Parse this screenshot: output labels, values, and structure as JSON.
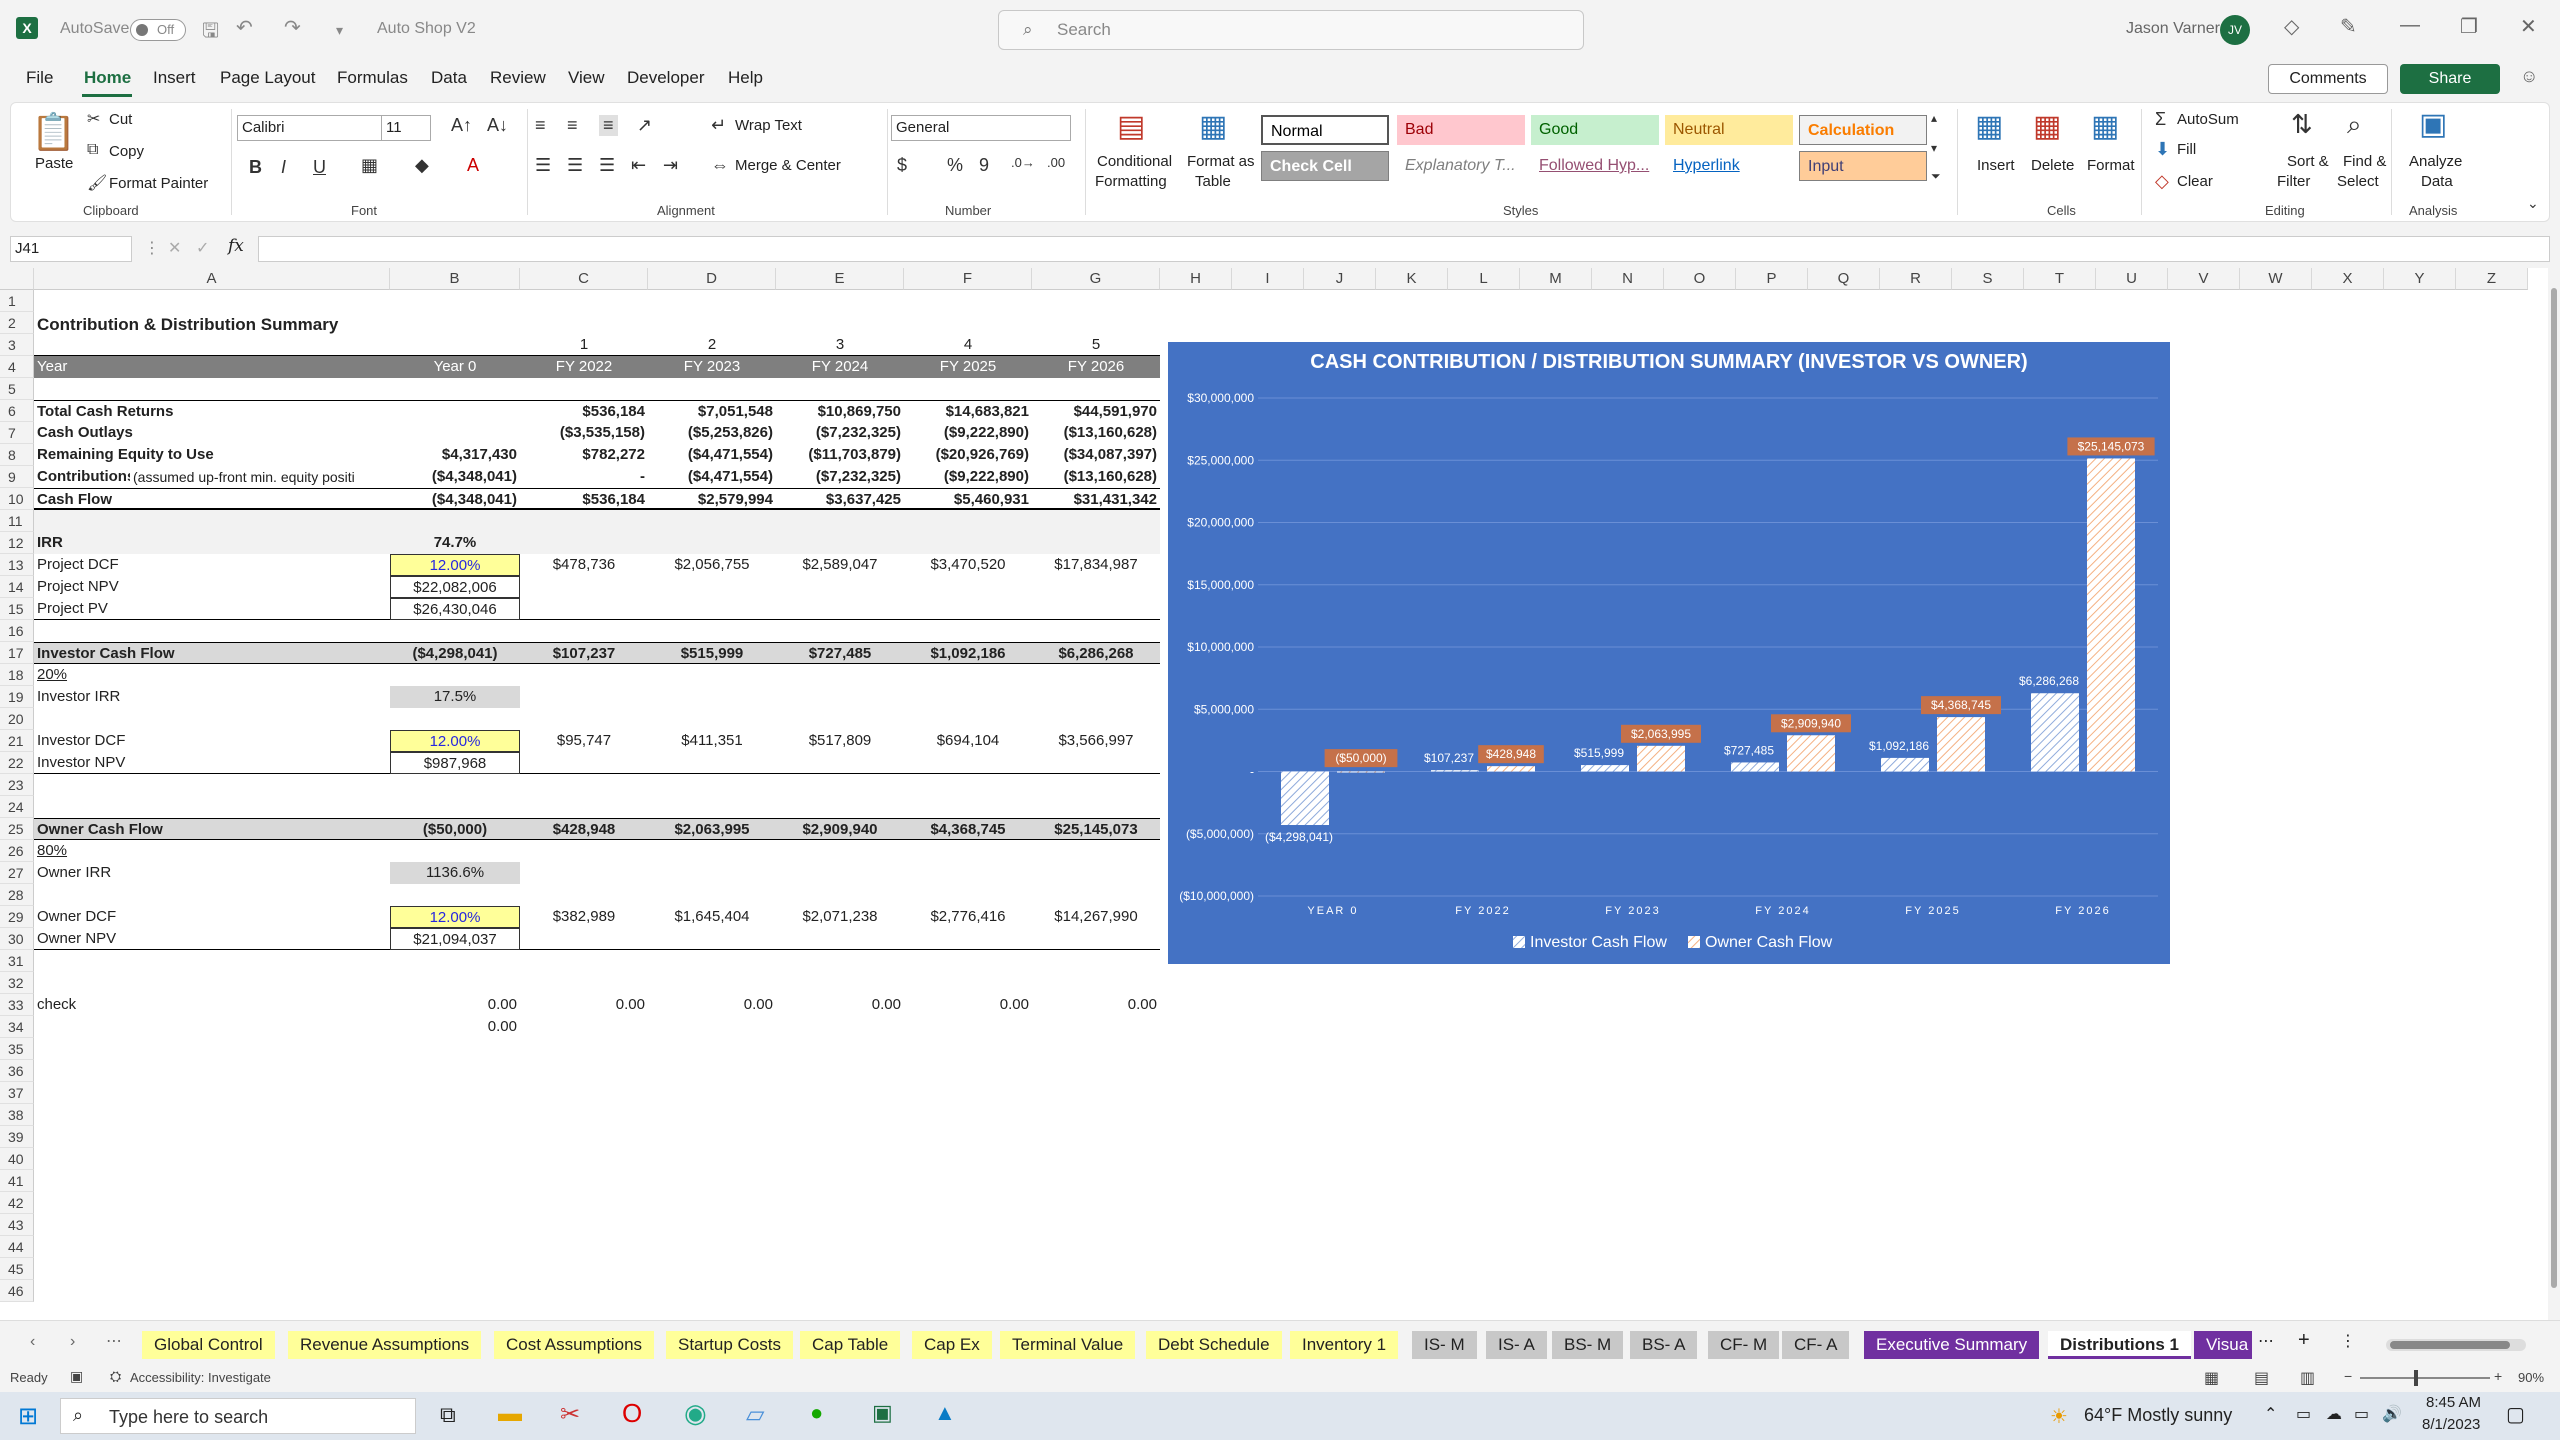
{
  "titlebar": {
    "autosave": "AutoSave",
    "toggle": "Off",
    "filename": "Auto Shop V2",
    "search_placeholder": "Search",
    "user": "Jason Varner",
    "initials": "JV"
  },
  "menu": [
    "File",
    "Home",
    "Insert",
    "Page Layout",
    "Formulas",
    "Data",
    "Review",
    "View",
    "Developer",
    "Help"
  ],
  "menu_buttons": {
    "comments": "Comments",
    "share": "Share"
  },
  "ribbon": {
    "paste": "Paste",
    "cut": "Cut",
    "copy": "Copy",
    "format_painter": "Format Painter",
    "clipboard": "Clipboard",
    "font_name": "Calibri",
    "font_size": "11",
    "font": "Font",
    "wrap_text": "Wrap Text",
    "merge_center": "Merge & Center",
    "alignment": "Alignment",
    "number_format": "General",
    "number": "Number",
    "conditional": "Conditional",
    "formatting": "Formatting",
    "format_as": "Format as",
    "table": "Table",
    "styles": [
      {
        "name": "Normal",
        "bg": "#ffffff",
        "fg": "#000000"
      },
      {
        "name": "Bad",
        "bg": "#ffc7ce",
        "fg": "#9c0006"
      },
      {
        "name": "Good",
        "bg": "#c6efce",
        "fg": "#006100"
      },
      {
        "name": "Neutral",
        "bg": "#ffeb9c",
        "fg": "#9c5700"
      },
      {
        "name": "Calculation",
        "bg": "#f2f2f2",
        "fg": "#fa7d00"
      },
      {
        "name": "Check Cell",
        "bg": "#a5a5a5",
        "fg": "#ffffff"
      },
      {
        "name": "Explanatory T...",
        "bg": "#ffffff",
        "fg": "#7f7f7f"
      },
      {
        "name": "Followed Hyp...",
        "bg": "#ffffff",
        "fg": "#954f72"
      },
      {
        "name": "Hyperlink",
        "bg": "#ffffff",
        "fg": "#0563c1"
      },
      {
        "name": "Input",
        "bg": "#ffcc99",
        "fg": "#3f3f76"
      }
    ],
    "styles_label": "Styles",
    "insert": "Insert",
    "delete": "Delete",
    "format": "Format",
    "cells": "Cells",
    "autosum": "AutoSum",
    "fill": "Fill",
    "clear": "Clear",
    "sort_filter": "Sort &",
    "filter": "Filter",
    "find_select": "Find &",
    "select": "Select",
    "editing": "Editing",
    "analyze": "Analyze",
    "data": "Data",
    "analysis": "Analysis"
  },
  "namebox": "J41",
  "columns": [
    "A",
    "B",
    "C",
    "D",
    "E",
    "F",
    "G",
    "H",
    "I",
    "J",
    "K",
    "L",
    "M",
    "N",
    "O",
    "P",
    "Q",
    "R",
    "S",
    "T",
    "U",
    "V",
    "W",
    "X",
    "Y",
    "Z"
  ],
  "rows": [
    "1",
    "2",
    "3",
    "4",
    "5",
    "6",
    "7",
    "8",
    "9",
    "10",
    "11",
    "12",
    "13",
    "14",
    "15",
    "16",
    "17",
    "18",
    "19",
    "20",
    "21",
    "22",
    "23",
    "24",
    "25",
    "26",
    "27",
    "28",
    "29",
    "30",
    "31",
    "32",
    "33",
    "34",
    "35",
    "36",
    "37",
    "38",
    "39",
    "40",
    "41",
    "42",
    "43",
    "44",
    "45",
    "46"
  ],
  "sheet": {
    "title": "Contribution & Distribution Summary",
    "year_nums": [
      "1",
      "2",
      "3",
      "4",
      "5"
    ],
    "header": [
      "Year",
      "Year 0",
      "FY 2022",
      "FY 2023",
      "FY 2024",
      "FY 2025",
      "FY 2026"
    ],
    "total_cash_returns": [
      "Total Cash Returns",
      "",
      "$536,184",
      "$7,051,548",
      "$10,869,750",
      "$14,683,821",
      "$44,591,970"
    ],
    "cash_outlays": [
      "Cash Outlays",
      "",
      "($3,535,158)",
      "($5,253,826)",
      "($7,232,325)",
      "($9,222,890)",
      "($13,160,628)"
    ],
    "remaining_equity": [
      "Remaining Equity to Use",
      "$4,317,430",
      "$782,272",
      "($4,471,554)",
      "($11,703,879)",
      "($20,926,769)",
      "($34,087,397)"
    ],
    "contributions": [
      "Contributions",
      "(assumed up-front min. equity positi",
      "($4,348,041)",
      "-",
      "($4,471,554)",
      "($7,232,325)",
      "($9,222,890)",
      "($13,160,628)"
    ],
    "cash_flow": [
      "Cash Flow",
      "($4,348,041)",
      "$536,184",
      "$2,579,994",
      "$3,637,425",
      "$5,460,931",
      "$31,431,342"
    ],
    "irr": [
      "IRR",
      "74.7%"
    ],
    "project_dcf": [
      "Project DCF",
      "12.00%",
      "$478,736",
      "$2,056,755",
      "$2,589,047",
      "$3,470,520",
      "$17,834,987"
    ],
    "project_npv": [
      "Project NPV",
      "$22,082,006"
    ],
    "project_pv": [
      "Project PV",
      "$26,430,046"
    ],
    "investor_cf": [
      "Investor Cash Flow",
      "($4,298,041)",
      "$107,237",
      "$515,999",
      "$727,485",
      "$1,092,186",
      "$6,286,268"
    ],
    "investor_pct": "20%",
    "investor_irr": [
      "Investor IRR",
      "17.5%"
    ],
    "investor_dcf": [
      "Investor DCF",
      "12.00%",
      "$95,747",
      "$411,351",
      "$517,809",
      "$694,104",
      "$3,566,997"
    ],
    "investor_npv": [
      "Investor NPV",
      "$987,968"
    ],
    "owner_cf": [
      "Owner Cash Flow",
      "($50,000)",
      "$428,948",
      "$2,063,995",
      "$2,909,940",
      "$4,368,745",
      "$25,145,073"
    ],
    "owner_pct": "80%",
    "owner_irr": [
      "Owner IRR",
      "1136.6%"
    ],
    "owner_dcf": [
      "Owner DCF",
      "12.00%",
      "$382,989",
      "$1,645,404",
      "$2,071,238",
      "$2,776,416",
      "$14,267,990"
    ],
    "owner_npv": [
      "Owner NPV",
      "$21,094,037"
    ],
    "check": [
      "check",
      "0.00",
      "0.00",
      "0.00",
      "0.00",
      "0.00",
      "0.00"
    ],
    "check2": "0.00"
  },
  "chart_data": {
    "type": "bar",
    "title": "CASH CONTRIBUTION / DISTRIBUTION SUMMARY (INVESTOR VS OWNER)",
    "categories": [
      "YEAR 0",
      "FY 2022",
      "FY 2023",
      "FY 2024",
      "FY 2025",
      "FY 2026"
    ],
    "series": [
      {
        "name": "Investor Cash Flow",
        "values": [
          -4298041,
          107237,
          515999,
          727485,
          1092186,
          6286268
        ],
        "labels": [
          "($4,298,041)",
          "$107,237",
          "$515,999",
          "$727,485",
          "$1,092,186",
          "$6,286,268"
        ]
      },
      {
        "name": "Owner Cash Flow",
        "values": [
          -50000,
          428948,
          2063995,
          2909940,
          4368745,
          25145073
        ],
        "labels": [
          "($50,000)",
          "$428,948",
          "$2,063,995",
          "$2,909,940",
          "$4,368,745",
          "$25,145,073"
        ]
      }
    ],
    "yticks": [
      30000000,
      25000000,
      20000000,
      15000000,
      10000000,
      5000000,
      0,
      -5000000,
      -10000000
    ],
    "ytick_labels": [
      "$30,000,000",
      "$25,000,000",
      "$20,000,000",
      "$15,000,000",
      "$10,000,000",
      "$5,000,000",
      "-",
      "($5,000,000)",
      "($10,000,000)"
    ],
    "ylim": [
      -10000000,
      30000000
    ],
    "legend": "bottom",
    "background": "#4472c4",
    "owner_label_bg": "#c5714a"
  },
  "tabs": [
    {
      "name": "Global Control",
      "color": "#ffff99"
    },
    {
      "name": "Revenue Assumptions",
      "color": "#ffff99"
    },
    {
      "name": "Cost Assumptions",
      "color": "#ffff99"
    },
    {
      "name": "Startup Costs",
      "color": "#ffff99"
    },
    {
      "name": "Cap Table",
      "color": "#ffff99"
    },
    {
      "name": "Cap Ex",
      "color": "#ffff99"
    },
    {
      "name": "Terminal Value",
      "color": "#ffff99"
    },
    {
      "name": "Debt Schedule",
      "color": "#ffff99"
    },
    {
      "name": "Inventory 1",
      "color": "#ffff99"
    },
    {
      "name": "IS- M",
      "color": "#c8c8c8"
    },
    {
      "name": "IS- A",
      "color": "#c8c8c8"
    },
    {
      "name": "BS- M",
      "color": "#c8c8c8"
    },
    {
      "name": "BS- A",
      "color": "#c8c8c8"
    },
    {
      "name": "CF- M",
      "color": "#c8c8c8"
    },
    {
      "name": "CF- A",
      "color": "#c8c8c8"
    },
    {
      "name": "Executive Summary",
      "color": "#7030a0"
    },
    {
      "name": "Distributions 1",
      "color": "#e8dcf2"
    },
    {
      "name": "Visua",
      "color": "#7030a0"
    }
  ],
  "status": {
    "ready": "Ready",
    "accessibility": "Accessibility: Investigate",
    "zoom": "90%"
  },
  "taskbar": {
    "search": "Type here to search",
    "weather": "64°F  Mostly sunny",
    "time": "8:45 AM",
    "date": "8/1/2023"
  }
}
